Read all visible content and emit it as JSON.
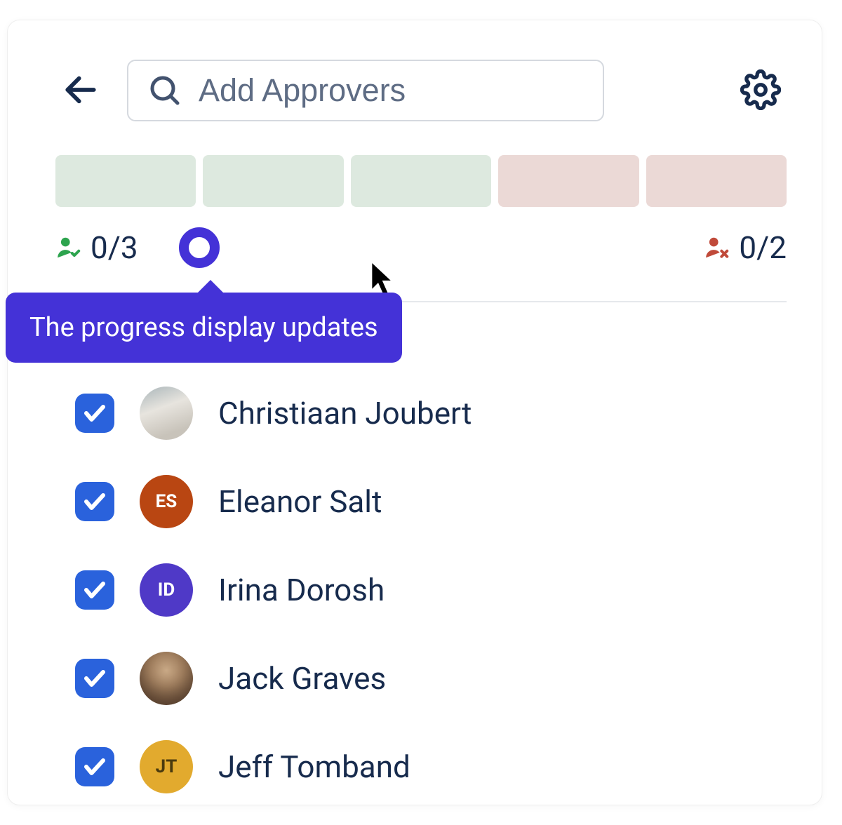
{
  "header": {
    "search_placeholder": "Add Approvers"
  },
  "progress": {
    "approve_count": "0/3",
    "reject_count": "0/2",
    "tooltip": "The progress display updates"
  },
  "people": [
    {
      "name": "Christiaan Joubert",
      "initials": "",
      "avatar_class": "photo1",
      "checked": true
    },
    {
      "name": "Eleanor Salt",
      "initials": "ES",
      "avatar_class": "es",
      "checked": true
    },
    {
      "name": "Irina Dorosh",
      "initials": "ID",
      "avatar_class": "id",
      "checked": true
    },
    {
      "name": "Jack Graves",
      "initials": "",
      "avatar_class": "photo2",
      "checked": true
    },
    {
      "name": "Jeff Tomband",
      "initials": "JT",
      "avatar_class": "jt",
      "checked": true
    }
  ]
}
